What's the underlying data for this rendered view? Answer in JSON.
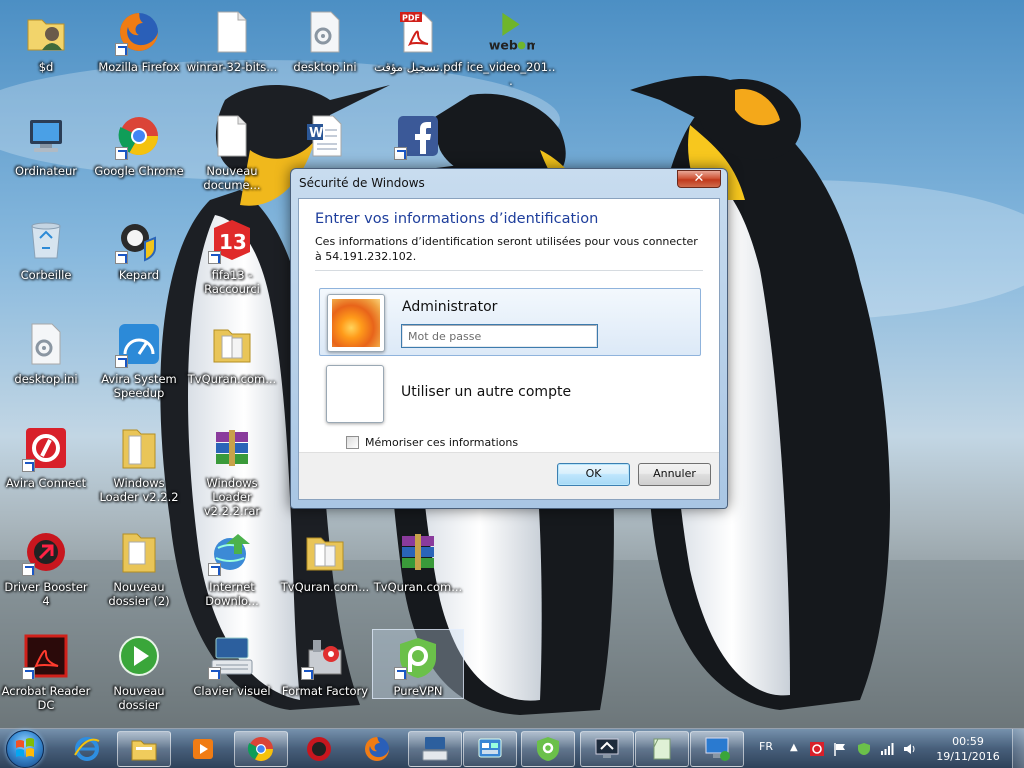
{
  "desktop": {
    "icons": [
      {
        "label": "$d",
        "icon": "user-folder-icon"
      },
      {
        "label": "Mozilla Firefox",
        "icon": "firefox-icon"
      },
      {
        "label": "winrar-32-bits...",
        "icon": "blank-file-icon"
      },
      {
        "label": "desktop.ini",
        "icon": "settings-file-icon"
      },
      {
        "label": "تسجيل مؤقت.pdf",
        "icon": "pdf-icon"
      },
      {
        "label": "ice_video_201...",
        "icon": "webm-icon"
      },
      {
        "label": "Ordinateur",
        "icon": "computer-icon"
      },
      {
        "label": "Google Chrome",
        "icon": "chrome-icon"
      },
      {
        "label": "Nouveau docume...",
        "icon": "blank-file-icon"
      },
      {
        "label": "",
        "icon": "word-document-icon"
      },
      {
        "label": "",
        "icon": "facebook-icon"
      },
      {
        "label": "Corbeille",
        "icon": "recycle-bin-icon"
      },
      {
        "label": "Kepard",
        "icon": "kepard-icon"
      },
      {
        "label": "fifa13 - Raccourci",
        "icon": "fifa13-icon"
      },
      {
        "label": "desktop.ini",
        "icon": "settings-file-icon"
      },
      {
        "label": "Avira System Speedup",
        "icon": "speedup-icon"
      },
      {
        "label": "TvQuran.com...",
        "icon": "folder-icon"
      },
      {
        "label": "Avira Connect",
        "icon": "avira-icon"
      },
      {
        "label": "Windows Loader v2.2.2",
        "icon": "folder-icon"
      },
      {
        "label": "Windows Loader v2.2.2.rar",
        "icon": "winrar-icon"
      },
      {
        "label": "Driver Booster 4",
        "icon": "driver-booster-icon"
      },
      {
        "label": "Nouveau dossier (2)",
        "icon": "folder-icon"
      },
      {
        "label": "Internet Downlo...",
        "icon": "idm-icon"
      },
      {
        "label": "TvQuran.com...",
        "icon": "folder-icon"
      },
      {
        "label": "TvQuran.com...",
        "icon": "winrar-icon"
      },
      {
        "label": "Acrobat Reader DC",
        "icon": "acrobat-icon"
      },
      {
        "label": "Nouveau dossier",
        "icon": "media-player-icon"
      },
      {
        "label": "Clavier visuel",
        "icon": "keyboard-icon"
      },
      {
        "label": "Format Factory",
        "icon": "format-factory-icon"
      },
      {
        "label": "PureVPN",
        "icon": "purevpn-icon"
      }
    ]
  },
  "dialog": {
    "title": "Sécurité de Windows",
    "close_glyph": "✕",
    "heading": "Entrer vos informations d’identification",
    "description": "Ces informations d’identification seront utilisées pour vous connecter à 54.191.232.102.",
    "account_name": "Administrator",
    "password_placeholder": "Mot de passe",
    "password_value": "",
    "other_account_label": "Utiliser un autre compte",
    "remember_label": "Mémoriser ces informations",
    "remember_checked": false,
    "ok_label": "OK",
    "cancel_label": "Annuler"
  },
  "taskbar": {
    "pinned": [
      "internet-explorer-icon",
      "file-explorer-icon",
      "media-center-icon",
      "chrome-icon",
      "driver-booster-icon",
      "firefox-icon",
      "keyboard-icon",
      "control-panel-icon",
      "purevpn-icon",
      "remote-desktop-icon",
      "notes-icon",
      "remote-desktop-connection-icon"
    ],
    "language": "FR",
    "time": "00:59",
    "date": "19/11/2016"
  }
}
